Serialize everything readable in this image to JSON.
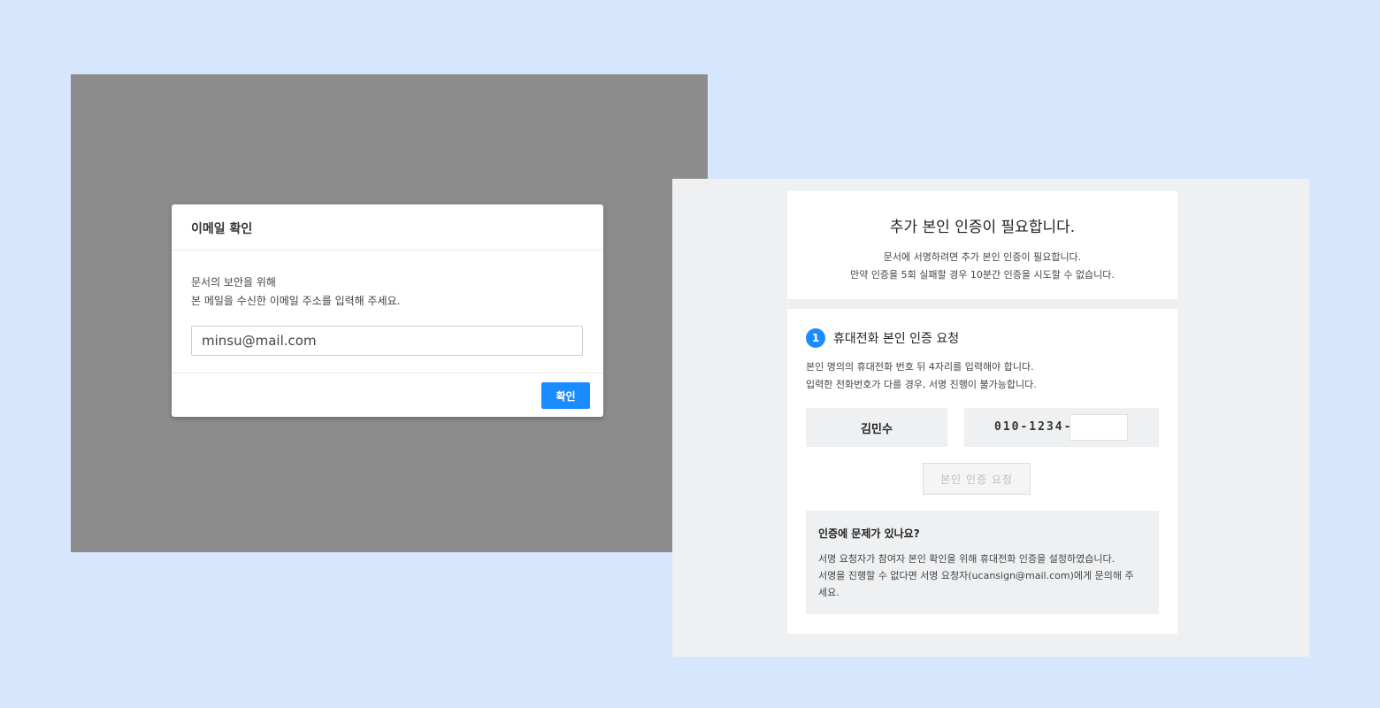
{
  "email_modal": {
    "title": "이메일 확인",
    "desc_line1": "문서의 보안을 위해",
    "desc_line2": "본 메일을 수신한 이메일 주소를 입력해 주세요.",
    "email_value": "minsu@mail.com",
    "confirm_label": "확인"
  },
  "verification": {
    "title": "추가 본인 인증이 필요합니다.",
    "sub_line1": "문서에 서명하려면 추가 본인 인증이 필요합니다.",
    "sub_line2": "만약 인증을 5회 실패할 경우 10분간 인증을 시도할 수 없습니다.",
    "step_number": "1",
    "step_title": "휴대전화 본인 인증 요청",
    "step_desc_line1": "본인 명의의 휴대전화 번호 뒤 4자리를 입력해야 합니다.",
    "step_desc_line2": "입력한 전화번호가 다를 경우, 서명 진행이 불가능합니다.",
    "name": "김민수",
    "phone_prefix": "010-1234-",
    "phone_last4": "",
    "request_label": "본인 인증 요청",
    "help_title": "인증에 문제가 있나요?",
    "help_line1": "서명 요청자가 참여자 본인 확인을 위해 휴대전화 인증을 설정하였습니다.",
    "help_line2": "서명을 진행할 수 없다면 서명 요청자(ucansign@mail.com)에게 문의해 주",
    "help_line3": "세요."
  },
  "colors": {
    "page_bg": "#d6e6fc",
    "overlay": "#8c8c8c",
    "accent": "#1a8cff",
    "panel_bg": "#eef0f2"
  }
}
